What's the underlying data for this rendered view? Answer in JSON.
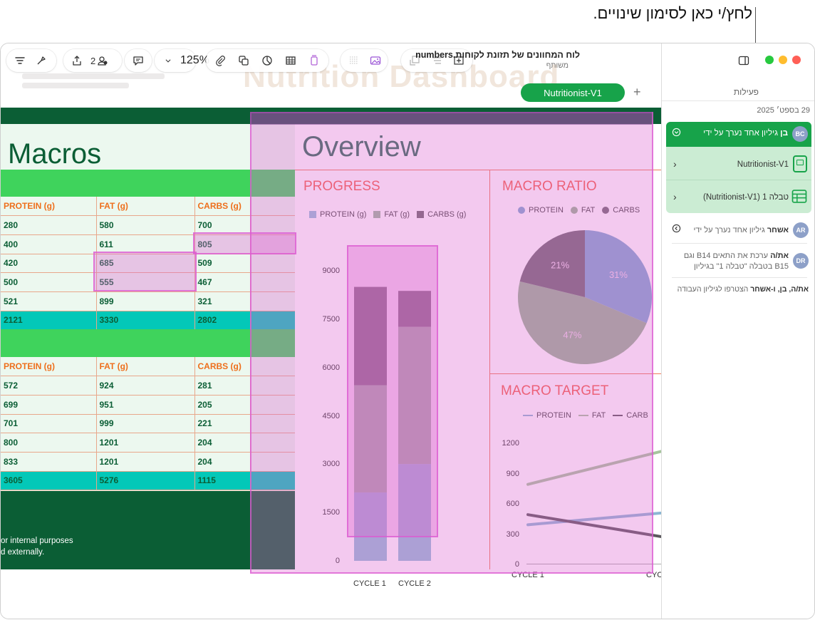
{
  "callout": {
    "text": "לחץ/י כאן לסימון שינויים."
  },
  "window": {
    "file_title": "לוח המחוונים של תזונת לקוחות.numbers",
    "file_subtitle": "משותף"
  },
  "toolbar": {
    "icons": [
      "view-menu-icon",
      "format-brush-icon",
      "share-icon",
      "collaborate-icon",
      "comment-icon",
      "zoom-chevron-icon",
      "attach-icon",
      "shape-icon",
      "chart-icon",
      "table-icon",
      "text-icon",
      "grid-icon",
      "media-icon",
      "organize-icon",
      "sort-icon",
      "add-row-icon"
    ],
    "collab_count": "2",
    "zoom": "125%"
  },
  "tabs": {
    "active": "Nutritionist-V1",
    "add": "+"
  },
  "sheet": {
    "ghost_title": "Nutrition Dashboard",
    "macros_title": "Macros",
    "overview_title": "Overview",
    "table1": {
      "headers": [
        "PROTEIN (g)",
        "FAT (g)",
        "CARBS (g)",
        ""
      ],
      "rows": [
        [
          "280",
          "580",
          "700",
          ""
        ],
        [
          "400",
          "611",
          "805",
          ""
        ],
        [
          "420",
          "685",
          "509",
          ""
        ],
        [
          "500",
          "555",
          "467",
          ""
        ],
        [
          "521",
          "899",
          "321",
          ""
        ]
      ],
      "total": [
        "2121",
        "3330",
        "2802",
        ""
      ]
    },
    "table2": {
      "headers": [
        "PROTEIN (g)",
        "FAT (g)",
        "CARBS (g)",
        ""
      ],
      "rows": [
        [
          "572",
          "924",
          "281",
          ""
        ],
        [
          "699",
          "951",
          "205",
          ""
        ],
        [
          "701",
          "999",
          "221",
          ""
        ],
        [
          "800",
          "1201",
          "204",
          ""
        ],
        [
          "833",
          "1201",
          "204",
          ""
        ]
      ],
      "total": [
        "3605",
        "5276",
        "1115",
        ""
      ]
    },
    "footnote_line1": "or internal purposes",
    "footnote_line2": "d externally."
  },
  "chart_data": [
    {
      "type": "bar",
      "title": "PROGRESS",
      "stacked": true,
      "categories": [
        "CYCLE 1",
        "CYCLE 2"
      ],
      "series": [
        {
          "name": "PROTEIN (g)",
          "values": [
            2121,
            3005
          ],
          "color": "#93c1d8"
        },
        {
          "name": "FAT (g)",
          "values": [
            3330,
            4257
          ],
          "color": "#9ab89b"
        },
        {
          "name": "CARBS (g)",
          "values": [
            3050,
            1115
          ],
          "color": "#6e6b6e"
        }
      ],
      "yticks": [
        "0",
        "1500",
        "3000",
        "4500",
        "6000",
        "7500",
        "9000"
      ],
      "ylim": [
        0,
        9000
      ]
    },
    {
      "type": "pie",
      "title": "MACRO RATIO",
      "series": [
        {
          "name": "PROTEIN",
          "value": 31,
          "label": "31%",
          "color": "#7fa9cf"
        },
        {
          "name": "FAT",
          "value": 47,
          "label": "47%",
          "color": "#97b594"
        },
        {
          "name": "CARBS",
          "value": 21,
          "label": "21%",
          "color": "#706b72"
        }
      ]
    },
    {
      "type": "line",
      "title": "MACRO TARGET",
      "categories": [
        "CYCLE 1",
        "CYC"
      ],
      "series": [
        {
          "name": "PROTEIN",
          "values": [
            400,
            560
          ],
          "color": "#8cb7d3"
        },
        {
          "name": "FAT",
          "values": [
            800,
            1250
          ],
          "color": "#a6c59d"
        },
        {
          "name": "CARB",
          "values": [
            500,
            200
          ],
          "color": "#5b585d"
        }
      ],
      "yticks": [
        "0",
        "300",
        "600",
        "900",
        "1200"
      ],
      "ylim": [
        0,
        1200
      ]
    }
  ],
  "sidebar": {
    "activity_label": "פעילות",
    "date": "29 בספט׳ 2025",
    "active_item": {
      "avatar": "BC",
      "text_bold": "בן",
      "text": "גיליון אחד נערך על ידי",
      "sub1": "Nutritionist-V1",
      "sub2": "טבלה 1 (Nutritionist-V1)"
    },
    "items": [
      {
        "avatar": "AR",
        "bold": "אשחר",
        "text": "גיליון אחד נערך על ידי"
      },
      {
        "avatar": "DR",
        "bold": "את/ה",
        "text": "ערכת את התאים B14 וגם",
        "text2": "B15 בטבלה \"טבלה 1\" בגיליון"
      }
    ],
    "joined_bold": "את/ה, בן, ו-אשחר",
    "joined_text": "הצטרפו לגיליון העבודה"
  }
}
